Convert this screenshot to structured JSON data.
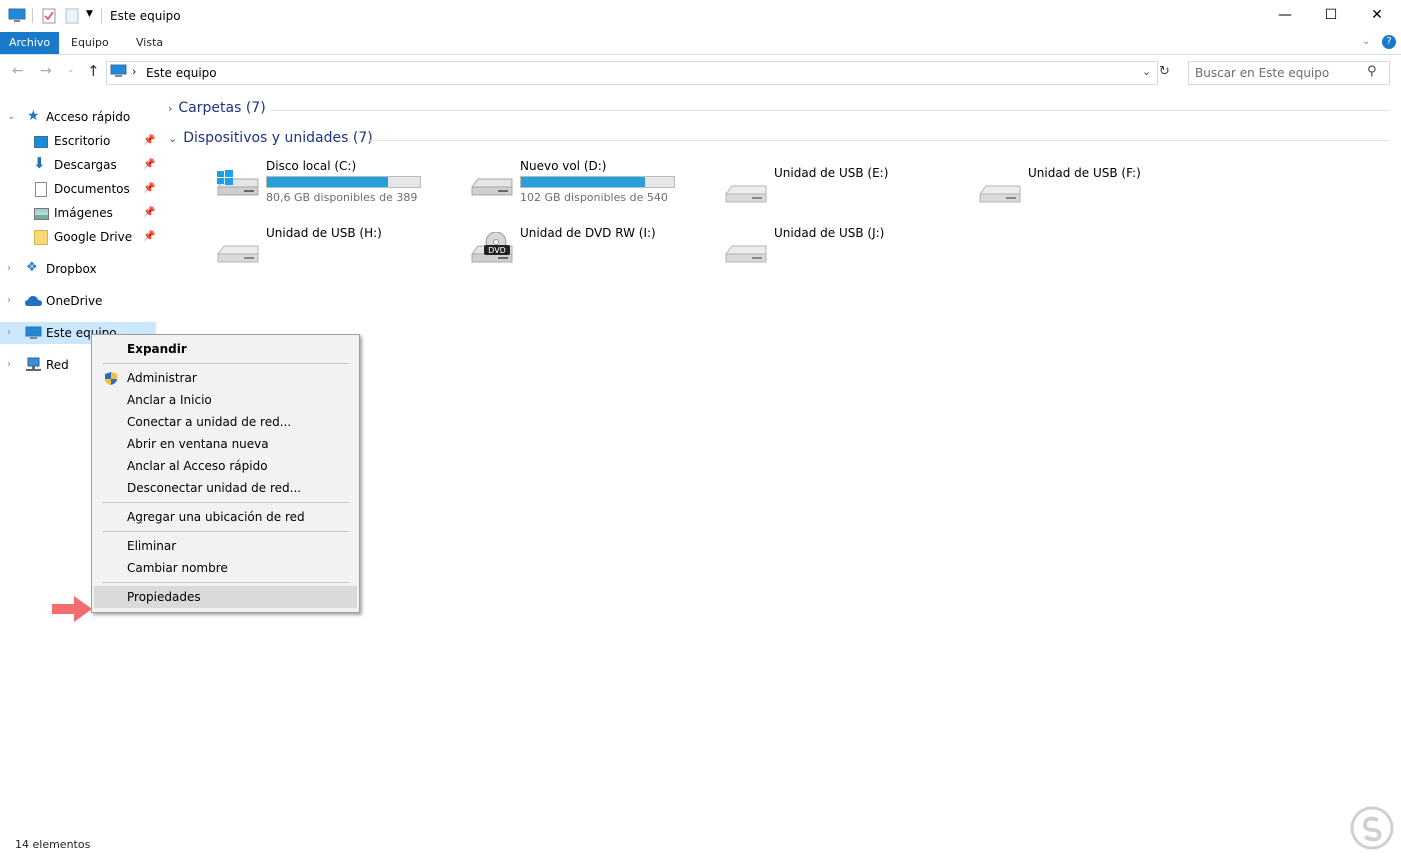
{
  "window": {
    "title": "Este equipo",
    "minimize": "—",
    "maximize": "☐",
    "close": "✕"
  },
  "ribbon": {
    "tabs": [
      "Archivo",
      "Equipo",
      "Vista"
    ]
  },
  "address": {
    "path": "Este equipo",
    "search_placeholder": "Buscar en Este equipo"
  },
  "nav": {
    "quick_access": "Acceso rápido",
    "quick_items": [
      "Escritorio",
      "Descargas",
      "Documentos",
      "Imágenes",
      "Google Drive"
    ],
    "roots": [
      "Dropbox",
      "OneDrive",
      "Este equipo",
      "Red"
    ]
  },
  "content": {
    "folders_header": "Carpetas (7)",
    "devices_header": "Dispositivos y unidades (7)",
    "drives": [
      {
        "name": "Disco local (C:)",
        "info": "80,6 GB disponibles de 389",
        "used_fraction": 0.79,
        "icon": "windows-drive-icon"
      },
      {
        "name": "Nuevo vol (D:)",
        "info": "102 GB disponibles de 540",
        "used_fraction": 0.81,
        "icon": "hard-drive-icon"
      },
      {
        "name": "Unidad de USB (E:)",
        "icon": "usb-drive-icon"
      },
      {
        "name": "Unidad de USB (F:)",
        "icon": "usb-drive-icon"
      },
      {
        "name": "Unidad de USB (H:)",
        "icon": "usb-drive-icon"
      },
      {
        "name": "Unidad de DVD RW (I:)",
        "icon": "dvd-drive-icon",
        "badge": "DVD"
      },
      {
        "name": "Unidad de USB (J:)",
        "icon": "usb-drive-icon"
      }
    ]
  },
  "context_menu": {
    "expand": "Expandir",
    "manage": "Administrar",
    "pin_start": "Anclar a Inicio",
    "map_drive": "Conectar a unidad de red...",
    "new_window": "Abrir en ventana nueva",
    "pin_quick": "Anclar al Acceso rápido",
    "disconnect": "Desconectar unidad de red...",
    "add_location": "Agregar una ubicación de red",
    "delete": "Eliminar",
    "rename": "Cambiar nombre",
    "properties": "Propiedades"
  },
  "status": {
    "count": "14 elementos"
  },
  "colors": {
    "accent": "#1979ca",
    "bar": "#26a0da",
    "arrow": "#f26d6d",
    "selection": "#cce8ff"
  }
}
